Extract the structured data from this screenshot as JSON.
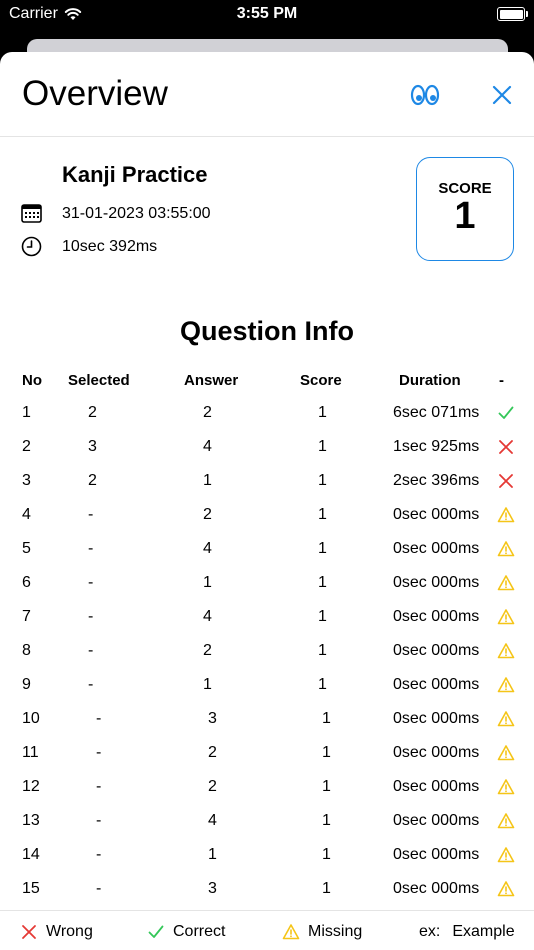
{
  "status": {
    "carrier": "Carrier",
    "time": "3:55 PM"
  },
  "header": {
    "title": "Overview"
  },
  "summary": {
    "quiz_name": "Kanji Practice",
    "date": "31-01-2023 03:55:00",
    "duration": "10sec 392ms",
    "score_label": "SCORE",
    "score_value": "1"
  },
  "questions": {
    "title": "Question Info",
    "columns": [
      "No",
      "Selected",
      "Answer",
      "Score",
      "Duration",
      "-"
    ],
    "rows": [
      {
        "no": "1",
        "selected": "2",
        "answer": "2",
        "score": "1",
        "duration": "6sec 071ms",
        "status": "correct"
      },
      {
        "no": "2",
        "selected": "3",
        "answer": "4",
        "score": "1",
        "duration": "1sec 925ms",
        "status": "wrong"
      },
      {
        "no": "3",
        "selected": "2",
        "answer": "1",
        "score": "1",
        "duration": "2sec 396ms",
        "status": "wrong"
      },
      {
        "no": "4",
        "selected": "-",
        "answer": "2",
        "score": "1",
        "duration": "0sec 000ms",
        "status": "missing"
      },
      {
        "no": "5",
        "selected": "-",
        "answer": "4",
        "score": "1",
        "duration": "0sec 000ms",
        "status": "missing"
      },
      {
        "no": "6",
        "selected": "-",
        "answer": "1",
        "score": "1",
        "duration": "0sec 000ms",
        "status": "missing"
      },
      {
        "no": "7",
        "selected": "-",
        "answer": "4",
        "score": "1",
        "duration": "0sec 000ms",
        "status": "missing"
      },
      {
        "no": "8",
        "selected": "-",
        "answer": "2",
        "score": "1",
        "duration": "0sec 000ms",
        "status": "missing"
      },
      {
        "no": "9",
        "selected": "-",
        "answer": "1",
        "score": "1",
        "duration": "0sec 000ms",
        "status": "missing"
      },
      {
        "no": "10",
        "selected": "-",
        "answer": "3",
        "score": "1",
        "duration": "0sec 000ms",
        "status": "missing"
      },
      {
        "no": "11",
        "selected": "-",
        "answer": "2",
        "score": "1",
        "duration": "0sec 000ms",
        "status": "missing"
      },
      {
        "no": "12",
        "selected": "-",
        "answer": "2",
        "score": "1",
        "duration": "0sec 000ms",
        "status": "missing"
      },
      {
        "no": "13",
        "selected": "-",
        "answer": "4",
        "score": "1",
        "duration": "0sec 000ms",
        "status": "missing"
      },
      {
        "no": "14",
        "selected": "-",
        "answer": "1",
        "score": "1",
        "duration": "0sec 000ms",
        "status": "missing"
      },
      {
        "no": "15",
        "selected": "-",
        "answer": "3",
        "score": "1",
        "duration": "0sec 000ms",
        "status": "missing"
      }
    ]
  },
  "legend": {
    "wrong": "Wrong",
    "correct": "Correct",
    "missing": "Missing",
    "example_key": "ex:",
    "example_value": "Example"
  },
  "colors": {
    "accent": "#1e88e5",
    "correct": "#34c759",
    "wrong": "#e53935",
    "missing": "#f5c518"
  }
}
